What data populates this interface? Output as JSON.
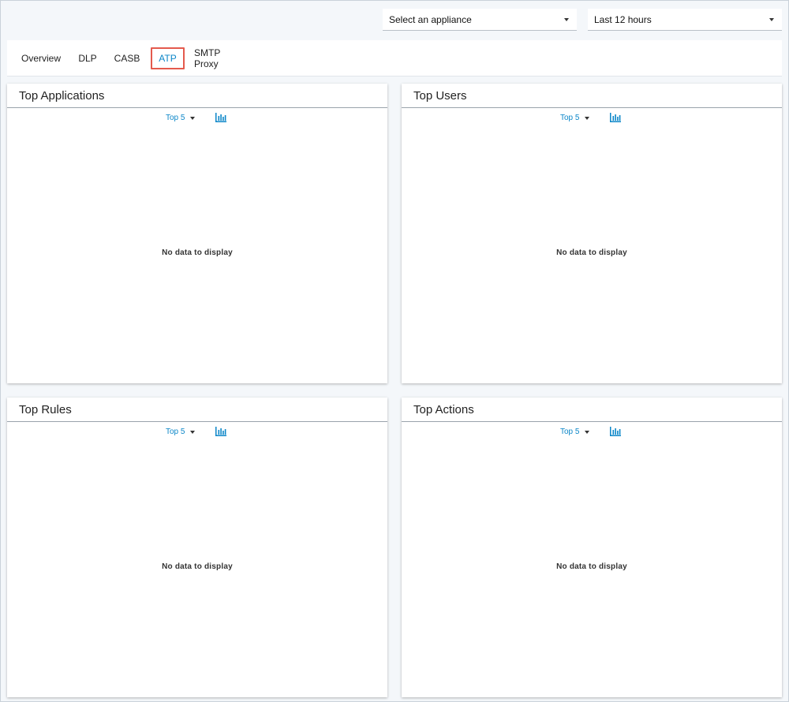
{
  "filters": {
    "appliance": "Select an appliance",
    "time_range": "Last 12 hours"
  },
  "tabs": [
    {
      "label": "Overview"
    },
    {
      "label": "DLP"
    },
    {
      "label": "CASB"
    },
    {
      "label": "ATP",
      "active": true
    },
    {
      "label": "SMTP Proxy"
    }
  ],
  "panels": [
    {
      "title": "Top Applications",
      "top_n": "Top 5",
      "empty_message": "No data to display"
    },
    {
      "title": "Top Users",
      "top_n": "Top 5",
      "empty_message": "No data to display"
    },
    {
      "title": "Top Rules",
      "top_n": "Top 5",
      "empty_message": "No data to display"
    },
    {
      "title": "Top Actions",
      "top_n": "Top 5",
      "empty_message": "No data to display"
    }
  ],
  "colors": {
    "accent": "#0b86c8",
    "active_tab_outline": "#e45a4d"
  }
}
